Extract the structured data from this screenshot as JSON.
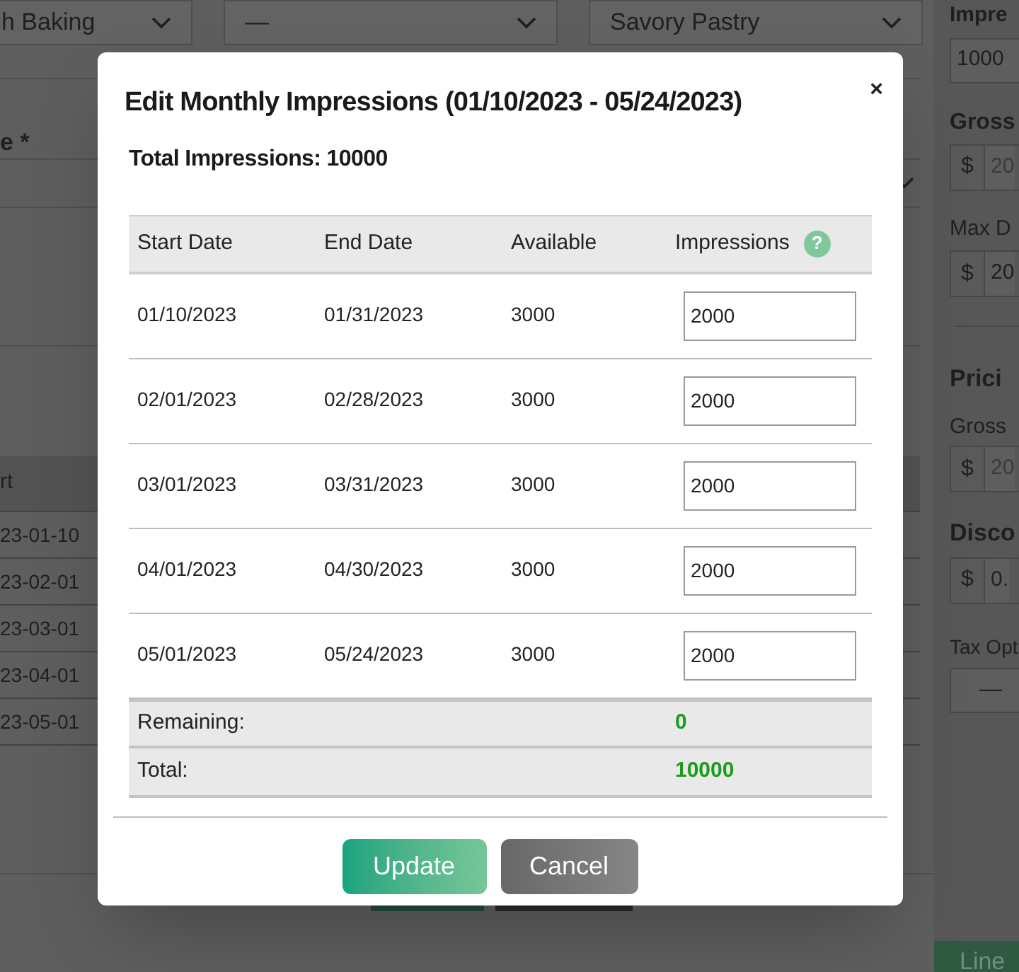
{
  "background": {
    "top_selects": [
      "h Baking",
      "—",
      "Savory Pastry"
    ],
    "field_label": "e *",
    "table_header": "rt",
    "table_dates": [
      "23-01-10",
      "23-02-01",
      "23-03-01",
      "23-04-01",
      "23-05-01"
    ],
    "side_panel": {
      "impressions_label": "Impre",
      "impressions_value": "1000",
      "gross_label": "Gross",
      "gross_value": "20",
      "max_label": "Max D",
      "max_value": "20",
      "pricing_heading": "Prici",
      "pricing_gross_label": "Gross",
      "pricing_gross_value": "20",
      "discount_heading": "Disco",
      "discount_value": "0.",
      "tax_label": "Tax Opt",
      "tax_value": "—",
      "currency": "$",
      "line_button": "Line"
    }
  },
  "dialog": {
    "title": "Edit Monthly Impressions (01/10/2023 - 05/24/2023)",
    "close": "×",
    "total": "Total Impressions: 10000",
    "columns": [
      "Start Date",
      "End Date",
      "Available",
      "Impressions"
    ],
    "help_icon": "?",
    "rows": [
      {
        "start": "01/10/2023",
        "end": "01/31/2023",
        "available": "3000",
        "impressions": "2000"
      },
      {
        "start": "02/01/2023",
        "end": "02/28/2023",
        "available": "3000",
        "impressions": "2000"
      },
      {
        "start": "03/01/2023",
        "end": "03/31/2023",
        "available": "3000",
        "impressions": "2000"
      },
      {
        "start": "04/01/2023",
        "end": "04/30/2023",
        "available": "3000",
        "impressions": "2000"
      },
      {
        "start": "05/01/2023",
        "end": "05/24/2023",
        "available": "3000",
        "impressions": "2000"
      }
    ],
    "summary": [
      {
        "label": "Remaining:",
        "value": "0"
      },
      {
        "label": "Total:",
        "value": "10000"
      }
    ],
    "buttons": [
      {
        "label": "Update",
        "kind": "primary"
      },
      {
        "label": "Cancel",
        "kind": "secondary"
      }
    ]
  }
}
